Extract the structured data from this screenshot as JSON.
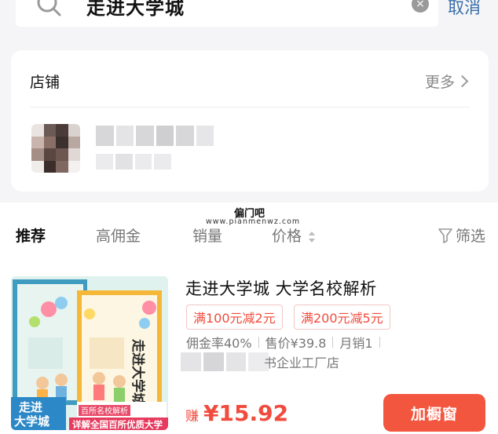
{
  "search": {
    "value": "走进大学城",
    "cancel_label": "取消"
  },
  "shops": {
    "title": "店铺",
    "more_label": "更多"
  },
  "watermark": {
    "main": "偏门吧",
    "sub": "www.pianmenwz.com"
  },
  "sort": {
    "tabs": [
      "推荐",
      "高佣金",
      "销量",
      "价格"
    ],
    "filter_label": "筛选"
  },
  "product": {
    "title": "走进大学城 大学名校解析",
    "coupons": [
      "满100元减2元",
      "满200元减5元"
    ],
    "commission": "佣金率40%",
    "sale_price": "售价¥39.8",
    "monthly_sales": "月销1",
    "store_suffix": "书企业工厂店",
    "earn_label": "赚",
    "earn_price": "¥15.92",
    "add_button": "加橱窗",
    "cover": {
      "book_title": "走进大学城",
      "banner_left": "走进\n大学城",
      "banner_top": "百所名校解析",
      "banner_bottom": "详解全国百所优质大学"
    }
  },
  "colors": {
    "accent": "#f3563f",
    "price": "#f14b3d",
    "link": "#3a6ea8"
  }
}
